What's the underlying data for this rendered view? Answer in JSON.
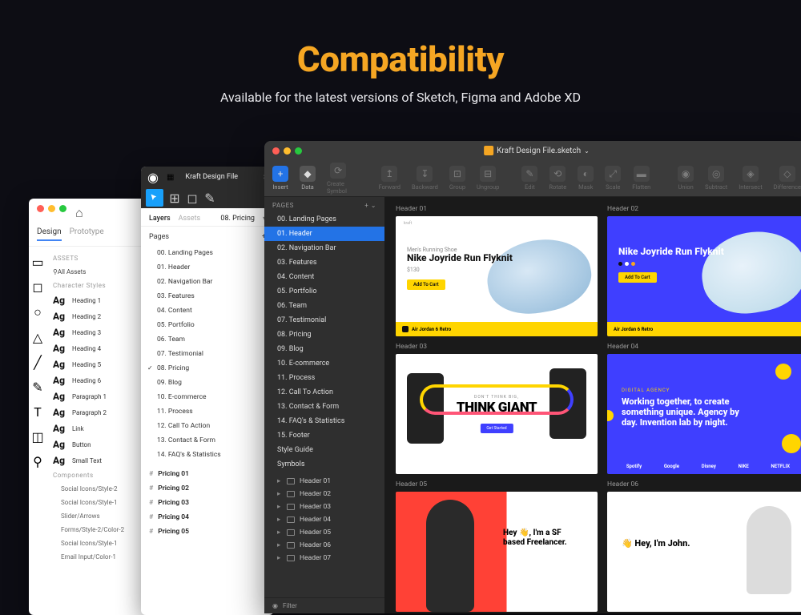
{
  "hero": {
    "title": "Compatibility",
    "subtitle": "Available for the latest versions of Sketch, Figma and Adobe XD"
  },
  "xd": {
    "home_icon": "home",
    "tabs": {
      "design": "Design",
      "prototype": "Prototype"
    },
    "assets_label": "ASSETS",
    "all_assets": "All Assets",
    "char_styles_label": "Character Styles",
    "styles": [
      "Heading 1",
      "Heading 2",
      "Heading 3",
      "Heading 4",
      "Heading 5",
      "Heading 6",
      "Paragraph 1",
      "Paragraph 2",
      "Link",
      "Button",
      "Small Text"
    ],
    "components_label": "Components",
    "components": [
      "Social Icons/Style-2",
      "Social Icons/Style-1",
      "Slider/Arrows",
      "Forms/Style-2/Color-2",
      "Social Icons/Style-1",
      "Email Input/Color-1"
    ]
  },
  "figma": {
    "file_title": "Kraft Design File",
    "tabs": {
      "layers": "Layers",
      "assets": "Assets",
      "current_page": "08. Pricing"
    },
    "pages_label": "Pages",
    "pages": [
      "00. Landing Pages",
      "01. Header",
      "02. Navigation Bar",
      "03. Features",
      "04. Content",
      "05. Portfolio",
      "06. Team",
      "07. Testimonial",
      "08. Pricing",
      "09. Blog",
      "10. E-commerce",
      "11. Process",
      "12. Call To Action",
      "13. Contact & Form",
      "14. FAQ's & Statistics"
    ],
    "selected_page_index": 8,
    "artboards": [
      "Pricing 01",
      "Pricing 02",
      "Pricing 03",
      "Pricing 04",
      "Pricing 05"
    ]
  },
  "sketch": {
    "file_title": "Kraft Design File.sketch",
    "toolbar": {
      "insert": "Insert",
      "data": "Data",
      "create_symbol": "Create Symbol",
      "forward": "Forward",
      "backward": "Backward",
      "group": "Group",
      "ungroup": "Ungroup",
      "edit": "Edit",
      "rotate": "Rotate",
      "mask": "Mask",
      "scale": "Scale",
      "flatten": "Flatten",
      "union": "Union",
      "subtract": "Subtract",
      "intersect": "Intersect",
      "difference": "Difference"
    },
    "pages_label": "PAGES",
    "pages": [
      "00. Landing Pages",
      "01. Header",
      "02. Navigation Bar",
      "03. Features",
      "04. Content",
      "05. Portfolio",
      "06. Team",
      "07. Testimonial",
      "08. Pricing",
      "09. Blog",
      "10. E-commerce",
      "11. Process",
      "12. Call To Action",
      "13. Contact & Form",
      "14. FAQ's & Statistics",
      "15. Footer",
      "Style Guide",
      "Symbols"
    ],
    "selected_page_index": 1,
    "layers": [
      "Header 01",
      "Header 02",
      "Header 03",
      "Header 04",
      "Header 05",
      "Header 06",
      "Header 07"
    ],
    "filter_label": "Filter"
  },
  "canvas": {
    "headers": [
      "Header 01",
      "Header 02",
      "Header 03",
      "Header 04",
      "Header 05",
      "Header 06"
    ],
    "ab1": {
      "tag": "Men's Running Shoe",
      "title": "Nike Joyride Run Flyknit",
      "price": "$130",
      "cta": "Add To Cart",
      "footer": "Air Jordan 6 Retro"
    },
    "ab2": {
      "title": "Nike Joyride Run Flyknit",
      "cta": "Add To Cart",
      "footer": "Air Jordan 6 Retro"
    },
    "ab3": {
      "tag": "DON'T THINK BIG,",
      "title": "THINK GIANT",
      "cta": "Get Started"
    },
    "ab4": {
      "tag": "DIGITAL AGENCY",
      "title": "Working together, to create something unique. Agency by day. Invention lab by night.",
      "logos": [
        "Spotify",
        "Google",
        "Disney",
        "NIKE",
        "NETFLIX"
      ]
    },
    "ab5": {
      "title": "Hey 👋, I'm a SF based Freelancer."
    },
    "ab6": {
      "title": "👋 Hey, I'm John."
    }
  }
}
